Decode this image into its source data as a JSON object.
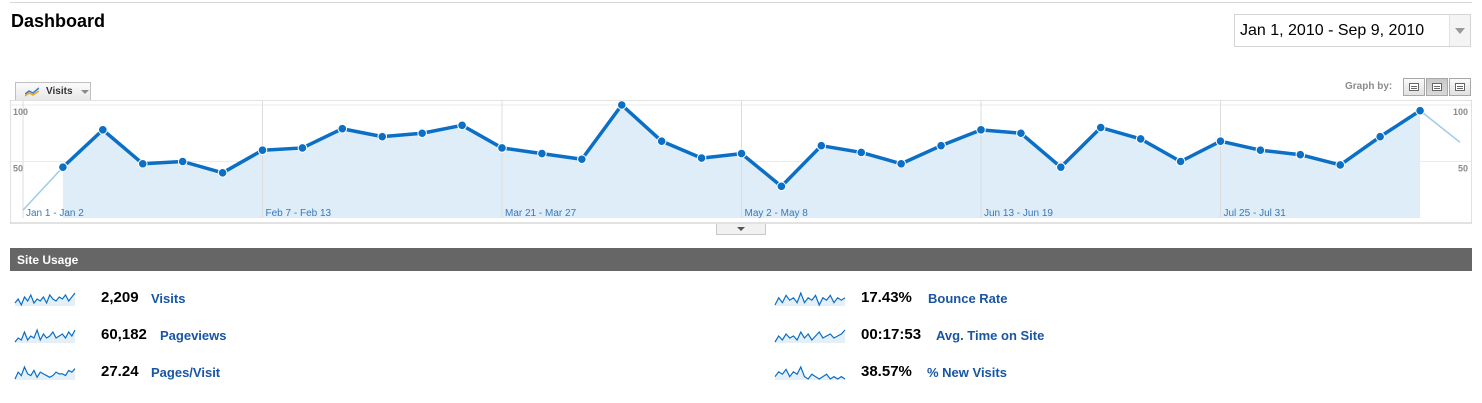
{
  "page": {
    "title": "Dashboard"
  },
  "date_range": {
    "label": "Jan 1, 2010 - Sep 9, 2010"
  },
  "graph_controls": {
    "metric_label": "Visits",
    "graph_by_label": "Graph by:"
  },
  "chart_data": {
    "type": "line",
    "title": "",
    "ylabel": "",
    "ylim": [
      0,
      100
    ],
    "y_ticks": [
      "100",
      "50"
    ],
    "x_tick_labels": [
      "Jan 1 - Jan 2",
      "Feb 7 - Feb 13",
      "Mar 21 - Mar 27",
      "May 2 - May 8",
      "Jun 13 - Jun 19",
      "Jul 25 - Jul 31"
    ],
    "series": [
      {
        "values": [
          7,
          45,
          78,
          48,
          50,
          40,
          60,
          62,
          79,
          72,
          75,
          82,
          62,
          57,
          52,
          100,
          68,
          53,
          57,
          28,
          64,
          58,
          48,
          64,
          78,
          75,
          45,
          80,
          70,
          50,
          68,
          60,
          56,
          47,
          72,
          95,
          67
        ]
      }
    ],
    "shaded_start": 1,
    "shaded_end": 35,
    "grid": true,
    "colors": {
      "line": "#0b6fc6",
      "fill": "#deedf8",
      "faded_line": "#9fcbe9"
    }
  },
  "site_usage": {
    "header": "Site Usage",
    "left": [
      {
        "value": "2,209",
        "label": "Visits"
      },
      {
        "value": "60,182",
        "label": "Pageviews"
      },
      {
        "value": "27.24",
        "label": "Pages/Visit"
      }
    ],
    "right": [
      {
        "value": "17.43%",
        "label": "Bounce Rate"
      },
      {
        "value": "00:17:53",
        "label": "Avg. Time on Site"
      },
      {
        "value": "38.57%",
        "label": "% New Visits"
      }
    ],
    "sparklines": [
      [
        5,
        7,
        4,
        8,
        6,
        9,
        5,
        7,
        6,
        8,
        5,
        9,
        7,
        6,
        8,
        7,
        9,
        6,
        8,
        10
      ],
      [
        4,
        6,
        5,
        9,
        5,
        7,
        6,
        10,
        5,
        8,
        6,
        7,
        9,
        6,
        7,
        8,
        6,
        9,
        7,
        10
      ],
      [
        3,
        7,
        5,
        10,
        6,
        5,
        8,
        4,
        7,
        6,
        5,
        4,
        5,
        7,
        6,
        6,
        5,
        8,
        7,
        9
      ],
      [
        5,
        8,
        6,
        9,
        7,
        8,
        6,
        10,
        6,
        8,
        7,
        9,
        5,
        8,
        7,
        9,
        6,
        8,
        7,
        8
      ],
      [
        4,
        7,
        5,
        8,
        6,
        7,
        5,
        9,
        6,
        8,
        5,
        7,
        9,
        6,
        7,
        8,
        6,
        7,
        8,
        10
      ],
      [
        6,
        8,
        7,
        9,
        6,
        8,
        7,
        10,
        6,
        5,
        7,
        6,
        5,
        6,
        7,
        5,
        6,
        5,
        6,
        5
      ]
    ]
  },
  "colors": {
    "link": "#1856a4",
    "header_bg": "#666666",
    "accent": "#0b6fc6"
  }
}
